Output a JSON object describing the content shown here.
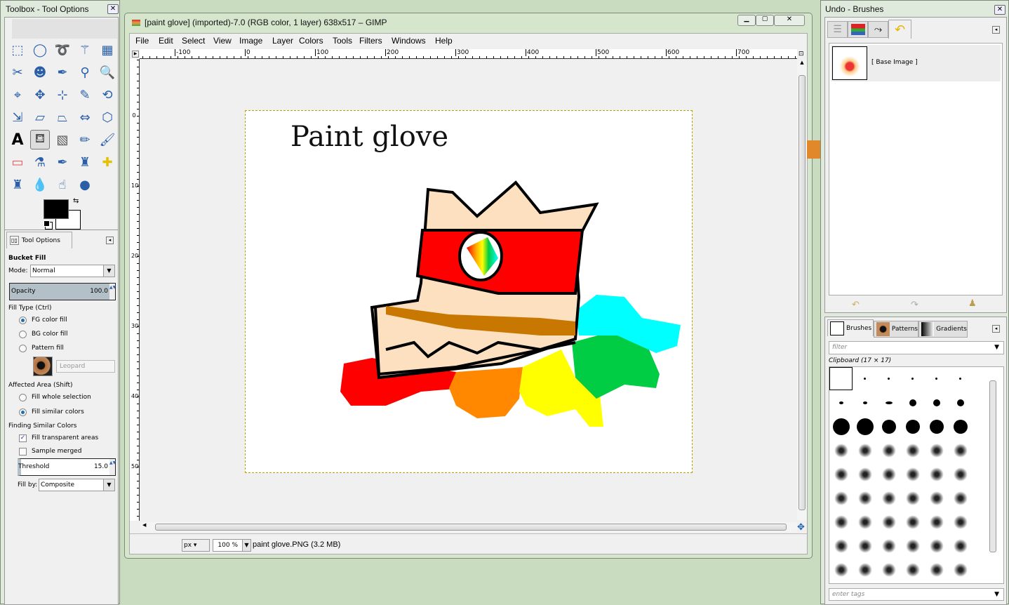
{
  "toolbox": {
    "title": "Toolbox - Tool Options",
    "tools": [
      "rect-select",
      "ellipse-select",
      "free-select",
      "fuzzy-select",
      "select-by-color",
      "scissors",
      "foreground-select",
      "paths",
      "color-picker",
      "zoom",
      "measure",
      "move",
      "align",
      "crop",
      "rotate",
      "scale",
      "shear",
      "perspective",
      "flip",
      "cage-transform",
      "text",
      "bucket-fill",
      "blend",
      "pencil",
      "paintbrush",
      "eraser",
      "airbrush",
      "ink",
      "clone",
      "heal",
      "perspective-clone",
      "blur-sharpen",
      "smudge",
      "dodge-burn"
    ],
    "active_tool": "bucket-fill",
    "fg_color": "#000000",
    "bg_color": "#ffffff"
  },
  "tool_options": {
    "tab_label": "Tool Options",
    "tool_name": "Bucket Fill",
    "mode_label": "Mode:",
    "mode_value": "Normal",
    "opacity_label": "Opacity",
    "opacity_value": "100.0",
    "fill_type_label": "Fill Type  (Ctrl)",
    "fill_types": [
      "FG color fill",
      "BG color fill",
      "Pattern fill"
    ],
    "fill_type_selected": 0,
    "pattern_name": "Leopard",
    "affected_area_label": "Affected Area  (Shift)",
    "affected_areas": [
      "Fill whole selection",
      "Fill similar colors"
    ],
    "affected_selected": 1,
    "finding_label": "Finding Similar Colors",
    "fill_transparent": {
      "label": "Fill transparent areas",
      "checked": true
    },
    "sample_merged": {
      "label": "Sample merged",
      "checked": false
    },
    "threshold_label": "Threshold",
    "threshold_value": "15.0",
    "fill_by_label": "Fill by:",
    "fill_by_value": "Composite"
  },
  "image_window": {
    "title": "[paint glove] (imported)-7.0 (RGB color, 1 layer) 638x517 – GIMP",
    "menu": [
      "File",
      "Edit",
      "Select",
      "View",
      "Image",
      "Layer",
      "Colors",
      "Tools",
      "Filters",
      "Windows",
      "Help"
    ],
    "hruler": [
      "-100",
      "0",
      "100",
      "200",
      "300",
      "400",
      "500",
      "600",
      "700"
    ],
    "vruler": [
      "0",
      "100",
      "200",
      "300",
      "400",
      "500"
    ],
    "unit": "px",
    "zoom": "100 %",
    "status": "paint glove.PNG (3.2 MB)",
    "canvas_text": "Paint glove"
  },
  "dock": {
    "title": "Undo - Brushes",
    "undo_item": "[ Base Image ]",
    "tabs": [
      "Brushes",
      "Patterns",
      "Gradients"
    ],
    "filter_placeholder": "filter",
    "brush_name": "Clipboard (17 × 17)",
    "tags_placeholder": "enter tags"
  }
}
